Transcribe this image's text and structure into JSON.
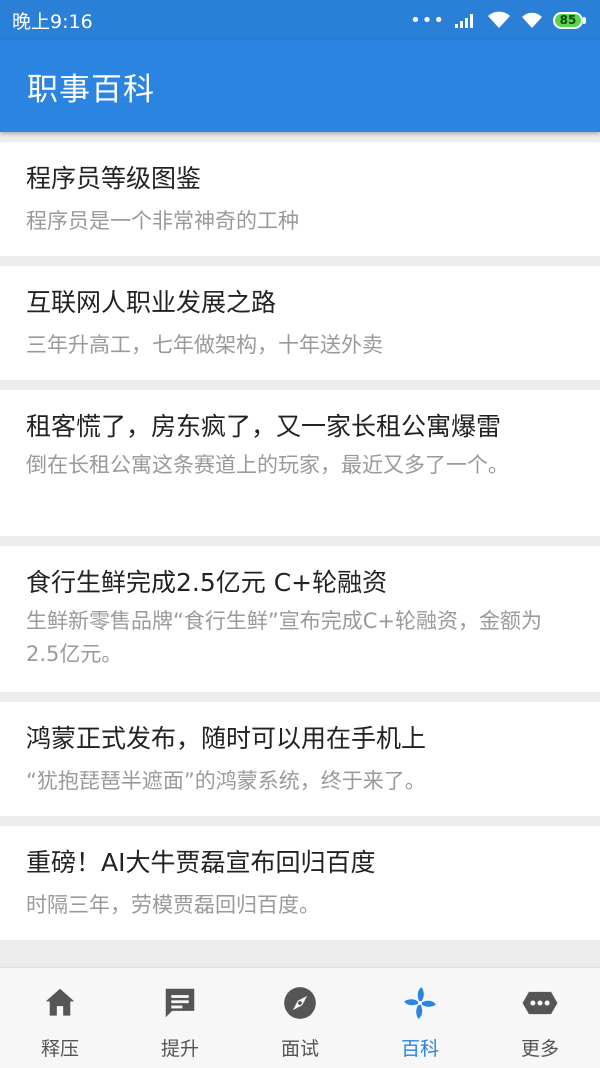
{
  "status": {
    "time": "晚上9:16",
    "battery": "85"
  },
  "appbar": {
    "title": "职事百科"
  },
  "articles": [
    {
      "title": "程序员等级图鉴",
      "desc": "程序员是一个非常神奇的工种"
    },
    {
      "title": "互联网人职业发展之路",
      "desc": "三年升高工，七年做架构，十年送外卖"
    },
    {
      "title": "租客慌了，房东疯了，又一家长租公寓爆雷",
      "desc": "倒在长租公寓这条赛道上的玩家，最近又多了一个。"
    },
    {
      "title": "食行生鲜完成2.5亿元 C+轮融资",
      "desc": "生鲜新零售品牌“食行生鲜”宣布完成C+轮融资，金额为2.5亿元。"
    },
    {
      "title": "鸿蒙正式发布，随时可以用在手机上",
      "desc": "“犹抱琵琶半遮面”的鸿蒙系统，终于来了。"
    },
    {
      "title": "重磅！AI大牛贾磊宣布回归百度",
      "desc": "时隔三年，劳模贾磊回归百度。"
    }
  ],
  "tabs": [
    {
      "label": "释压",
      "icon": "home-icon"
    },
    {
      "label": "提升",
      "icon": "chat-icon"
    },
    {
      "label": "面试",
      "icon": "compass-icon"
    },
    {
      "label": "百科",
      "icon": "pinwheel-icon"
    },
    {
      "label": "更多",
      "icon": "more-icon"
    }
  ],
  "colors": {
    "primary": "#2a84e0",
    "active_tab": "#2a84e0",
    "inactive_icon": "#555555"
  }
}
